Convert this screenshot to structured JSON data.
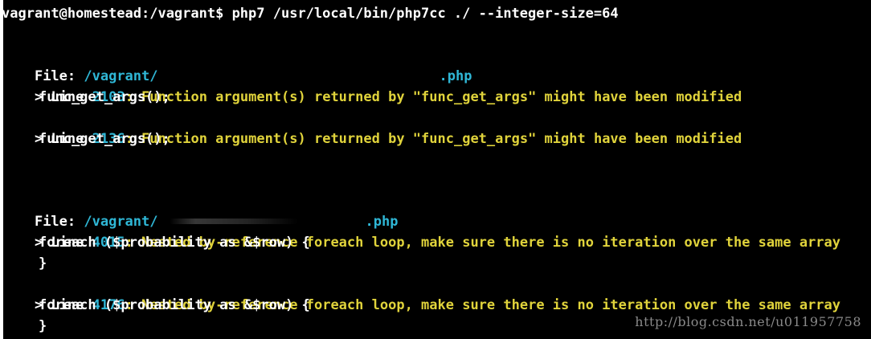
{
  "terminal": {
    "prompt": "vagrant@homestead:/vagrant$ php7 /usr/local/bin/php7cc ./ --integer-size=64",
    "files": [
      {
        "label": "File: ",
        "path_prefix": "/vagrant/",
        "path_suffix": ".php",
        "entries": [
          {
            "marker": "> ",
            "line_word": "Line ",
            "line_number": "2103",
            "message": ": Function argument(s) returned by \"func_get_args\" might have been modified",
            "code": [
              "func_get_args();"
            ]
          },
          {
            "marker": "> ",
            "line_word": "Line ",
            "line_number": "2136",
            "message": ": Function argument(s) returned by \"func_get_args\" might have been modified",
            "code": [
              "func_get_args();"
            ]
          }
        ]
      },
      {
        "label": "File: ",
        "path_prefix": "/vagrant/",
        "path_suffix": ".php",
        "entries": [
          {
            "marker": "> ",
            "line_word": "Line ",
            "line_number": "4015",
            "message": ": Nested by-reference foreach loop, make sure there is no iteration over the same array",
            "code": [
              "foreach ($probability as &$row) {",
              "}"
            ]
          },
          {
            "marker": "> ",
            "line_word": "Line ",
            "line_number": "4176",
            "message": ": Nested by-reference foreach loop, make sure there is no iteration over the same array",
            "code": [
              "foreach ($probability as &$row) {",
              "}"
            ]
          }
        ]
      }
    ]
  },
  "watermark": "http://blog.csdn.net/u011957758",
  "colors": {
    "background": "#000000",
    "text": "#ffffff",
    "path_and_numbers": "#2fb7d6",
    "messages": "#e0d33b"
  }
}
